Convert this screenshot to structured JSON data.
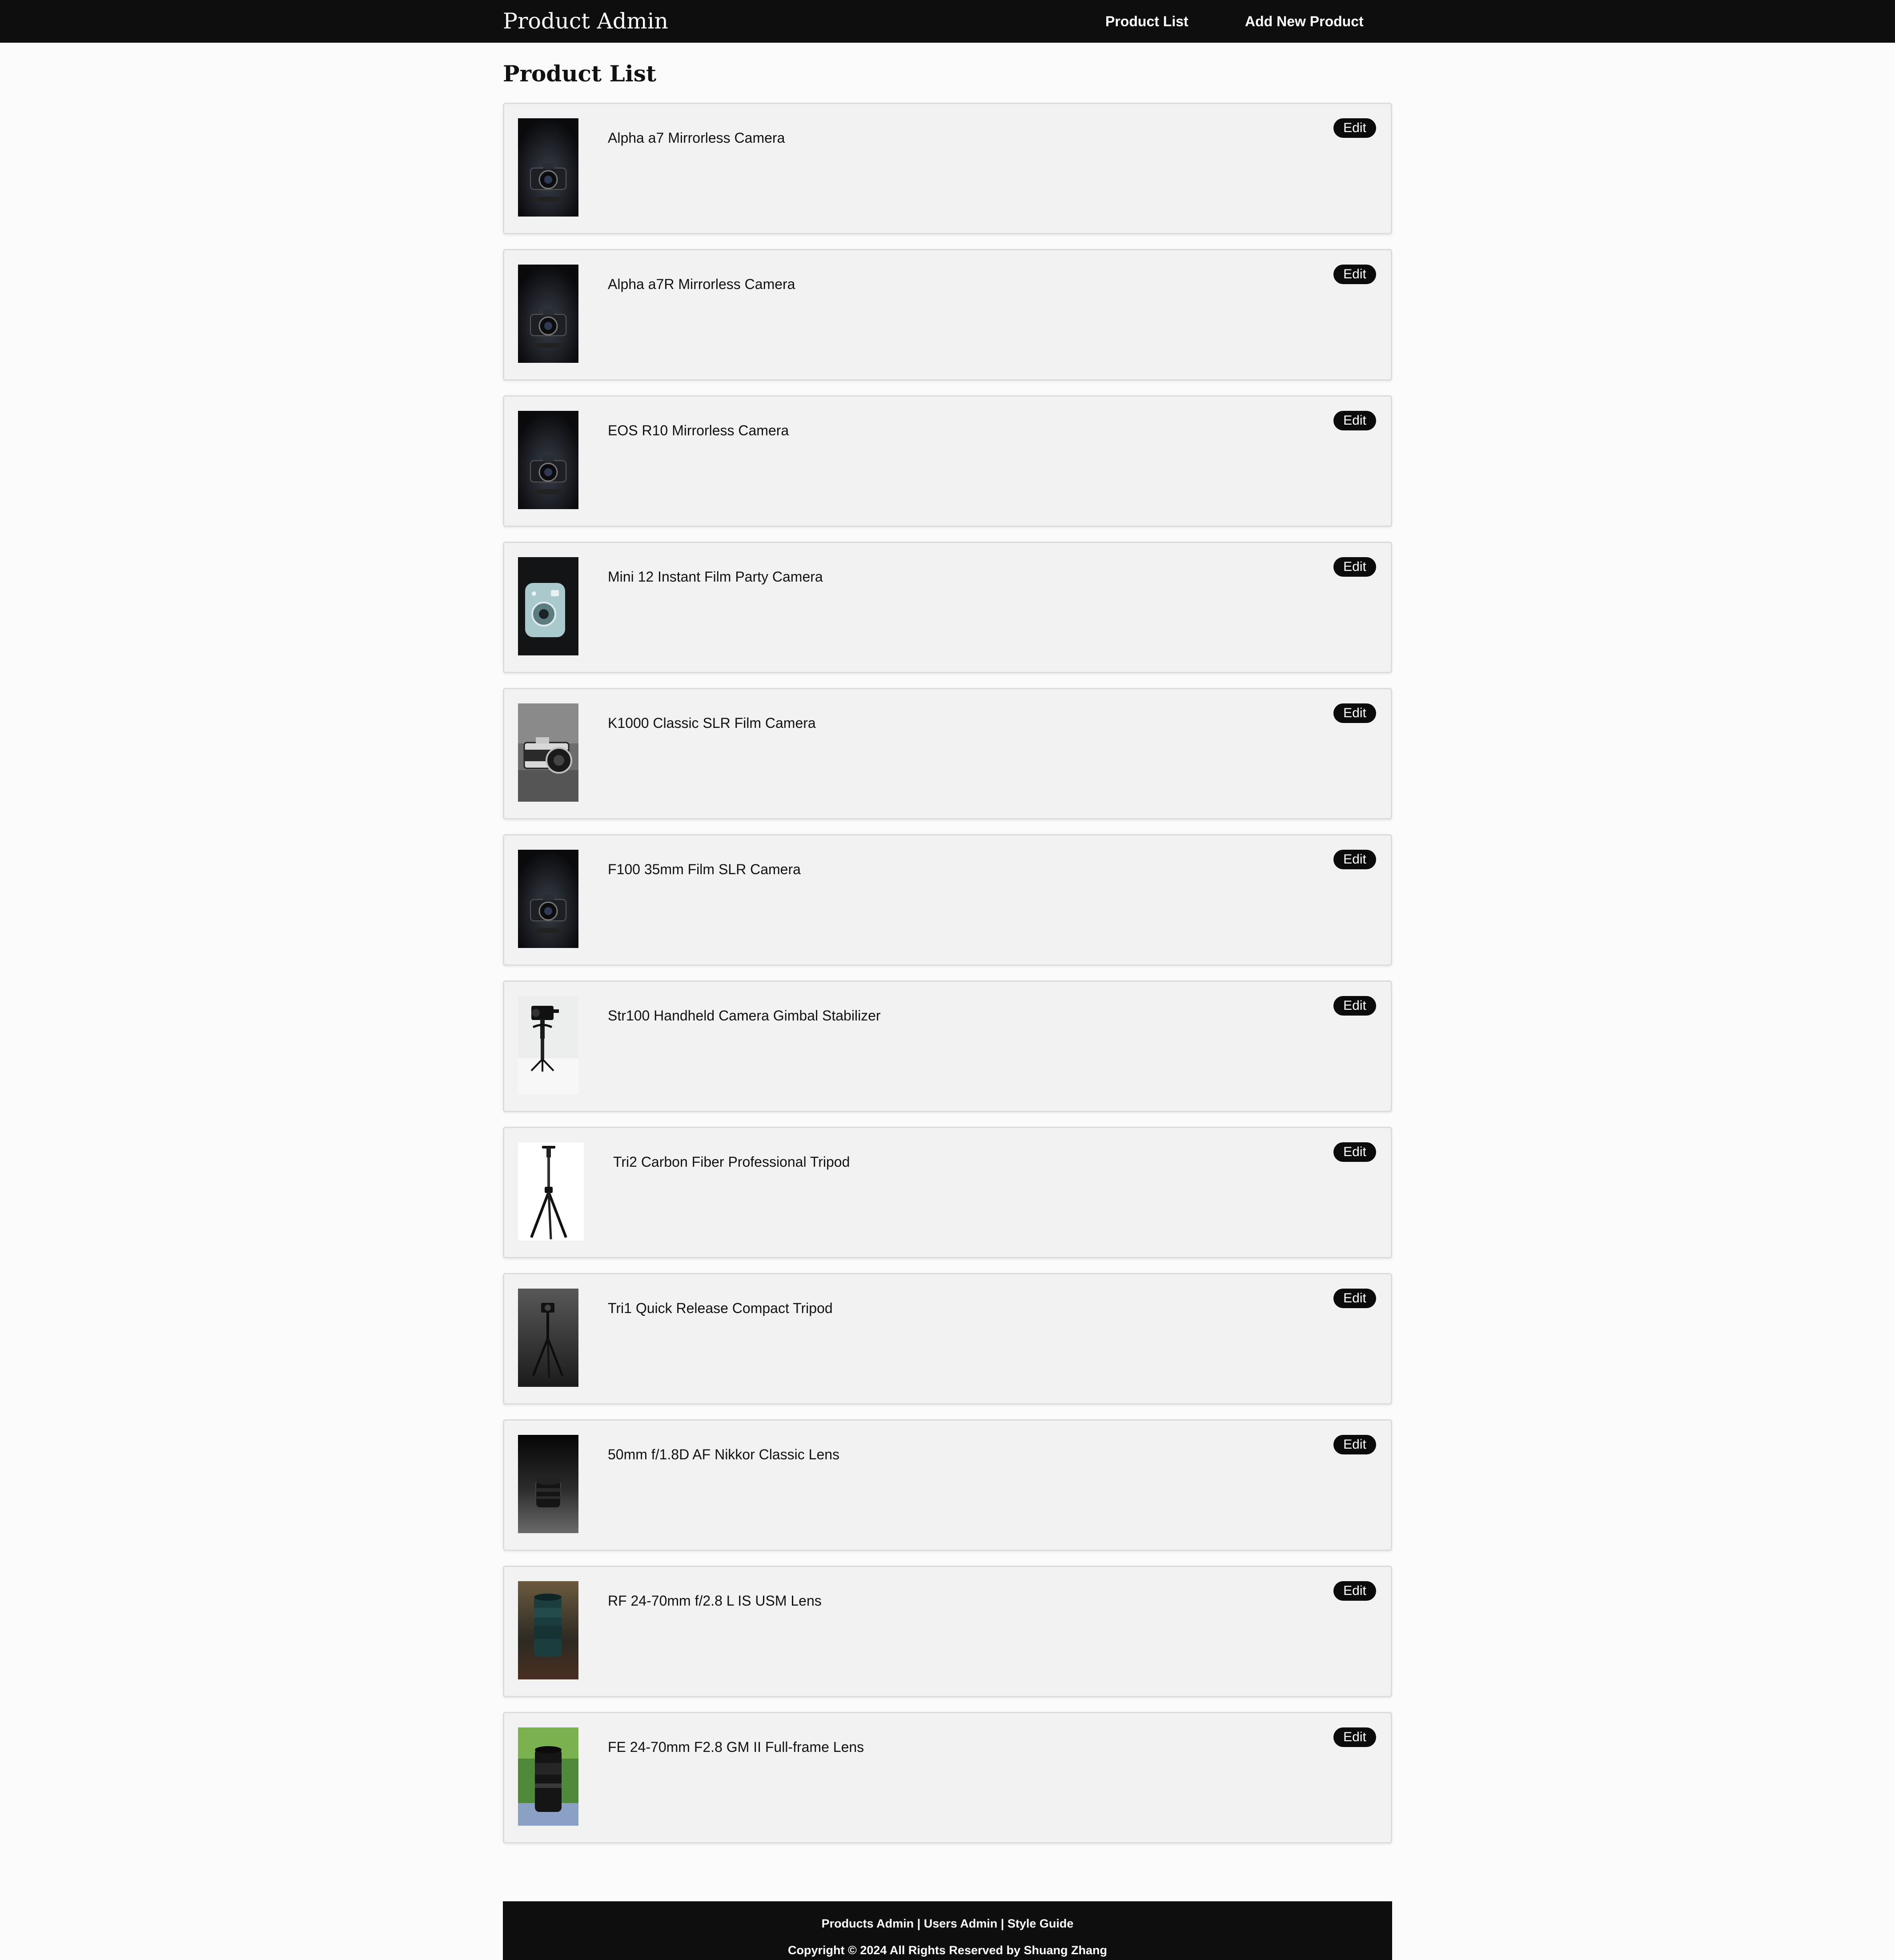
{
  "header": {
    "brand": "Product Admin",
    "nav": {
      "product_list": "Product List",
      "add_new_product": "Add New Product"
    }
  },
  "main": {
    "title": "Product List",
    "edit_label": "Edit",
    "products": [
      {
        "name": "Alpha a7 Mirrorless Camera",
        "thumbnail": "camera-dark"
      },
      {
        "name": "Alpha a7R Mirrorless Camera",
        "thumbnail": "camera-dark"
      },
      {
        "name": "EOS R10 Mirrorless Camera",
        "thumbnail": "camera-dark"
      },
      {
        "name": "Mini 12 Instant Film Party Camera",
        "thumbnail": "instant-camera"
      },
      {
        "name": "K1000 Classic SLR Film Camera",
        "thumbnail": "film-camera"
      },
      {
        "name": "F100 35mm Film SLR Camera",
        "thumbnail": "camera-dark"
      },
      {
        "name": "Str100 Handheld Camera Gimbal Stabilizer",
        "thumbnail": "gimbal"
      },
      {
        "name": "Tri2 Carbon Fiber Professional Tripod",
        "thumbnail": "tripod-white"
      },
      {
        "name": "Tri1 Quick Release Compact Tripod",
        "thumbnail": "tripod-grey"
      },
      {
        "name": "50mm f/1.8D AF Nikkor Classic Lens",
        "thumbnail": "lens-dark"
      },
      {
        "name": "RF 24-70mm f/2.8 L IS USM Lens",
        "thumbnail": "lens-teal"
      },
      {
        "name": "FE 24-70mm F2.8 GM II Full-frame Lens",
        "thumbnail": "lens-garden"
      }
    ]
  },
  "footer": {
    "links": [
      "Products Admin",
      "Users Admin",
      "Style Guide"
    ],
    "separator": "|",
    "copyright": "Copyright © 2024 All Rights Reserved by Shuang Zhang"
  },
  "colors": {
    "header_bg": "#0e0e0e",
    "card_bg": "#f2f2f2",
    "button_bg": "#0b0b0b",
    "page_bg": "#fbfbfb"
  }
}
